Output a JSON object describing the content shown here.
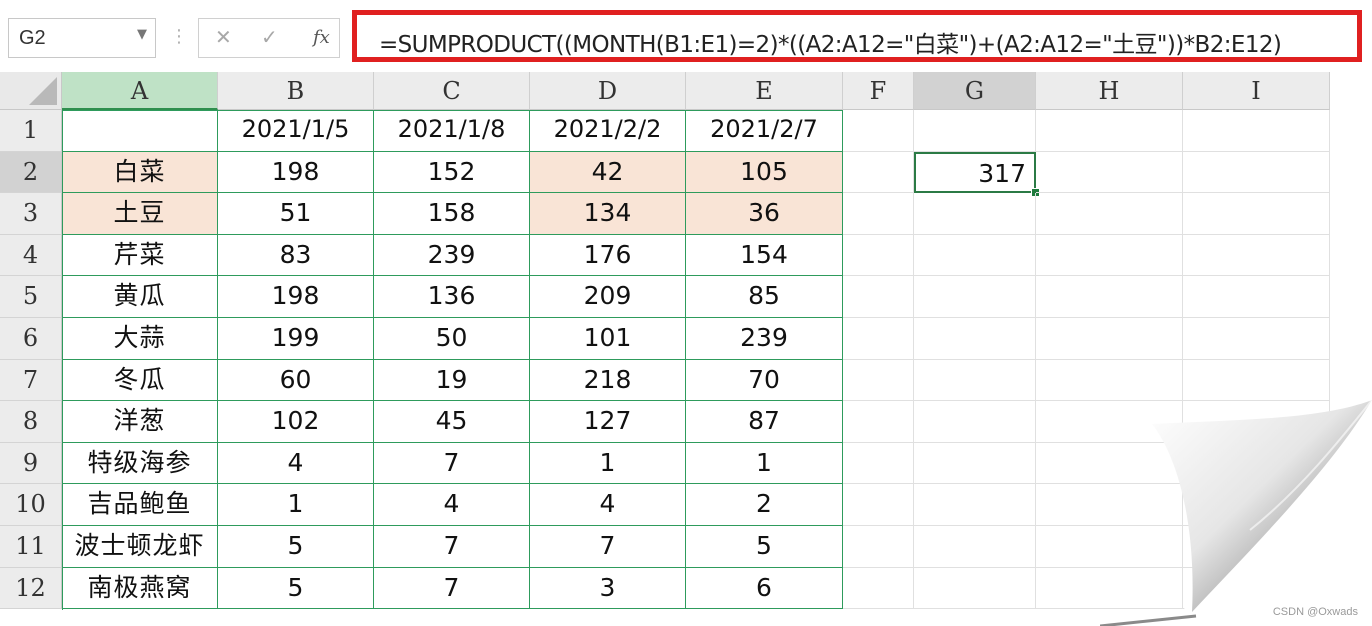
{
  "name_box": {
    "value": "G2"
  },
  "formula_bar": {
    "cancel_icon": "✕",
    "enter_icon": "✓",
    "fx_label": "fx",
    "formula": "=SUMPRODUCT((MONTH(B1:E1)=2)*((A2:A12=\"白菜\")+(A2:A12=\"土豆\"))*B2:E12)",
    "highlight_color": "#e02020"
  },
  "columns": [
    "A",
    "B",
    "C",
    "D",
    "E",
    "F",
    "G",
    "H",
    "I"
  ],
  "rows": [
    "1",
    "2",
    "3",
    "4",
    "5",
    "6",
    "7",
    "8",
    "9",
    "10",
    "11",
    "12"
  ],
  "table": {
    "dates": [
      "2021/1/5",
      "2021/1/8",
      "2021/2/2",
      "2021/2/7"
    ],
    "items": [
      {
        "name": "白菜",
        "values": [
          "198",
          "152",
          "42",
          "105"
        ]
      },
      {
        "name": "土豆",
        "values": [
          "51",
          "158",
          "134",
          "36"
        ]
      },
      {
        "name": "芹菜",
        "values": [
          "83",
          "239",
          "176",
          "154"
        ]
      },
      {
        "name": "黄瓜",
        "values": [
          "198",
          "136",
          "209",
          "85"
        ]
      },
      {
        "name": "大蒜",
        "values": [
          "199",
          "50",
          "101",
          "239"
        ]
      },
      {
        "name": "冬瓜",
        "values": [
          "60",
          "19",
          "218",
          "70"
        ]
      },
      {
        "name": "洋葱",
        "values": [
          "102",
          "45",
          "127",
          "87"
        ]
      },
      {
        "name": "特级海参",
        "values": [
          "4",
          "7",
          "1",
          "1"
        ]
      },
      {
        "name": "吉品鲍鱼",
        "values": [
          "1",
          "4",
          "4",
          "2"
        ]
      },
      {
        "name": "波士顿龙虾",
        "values": [
          "5",
          "7",
          "7",
          "5"
        ]
      },
      {
        "name": "南极燕窝",
        "values": [
          "5",
          "7",
          "3",
          "6"
        ]
      }
    ],
    "highlight_color": "#f9e4d6",
    "border_color": "#2e9b5c"
  },
  "result_cell": {
    "address": "G2",
    "value": "317"
  },
  "watermark": "CSDN @Oxwads"
}
